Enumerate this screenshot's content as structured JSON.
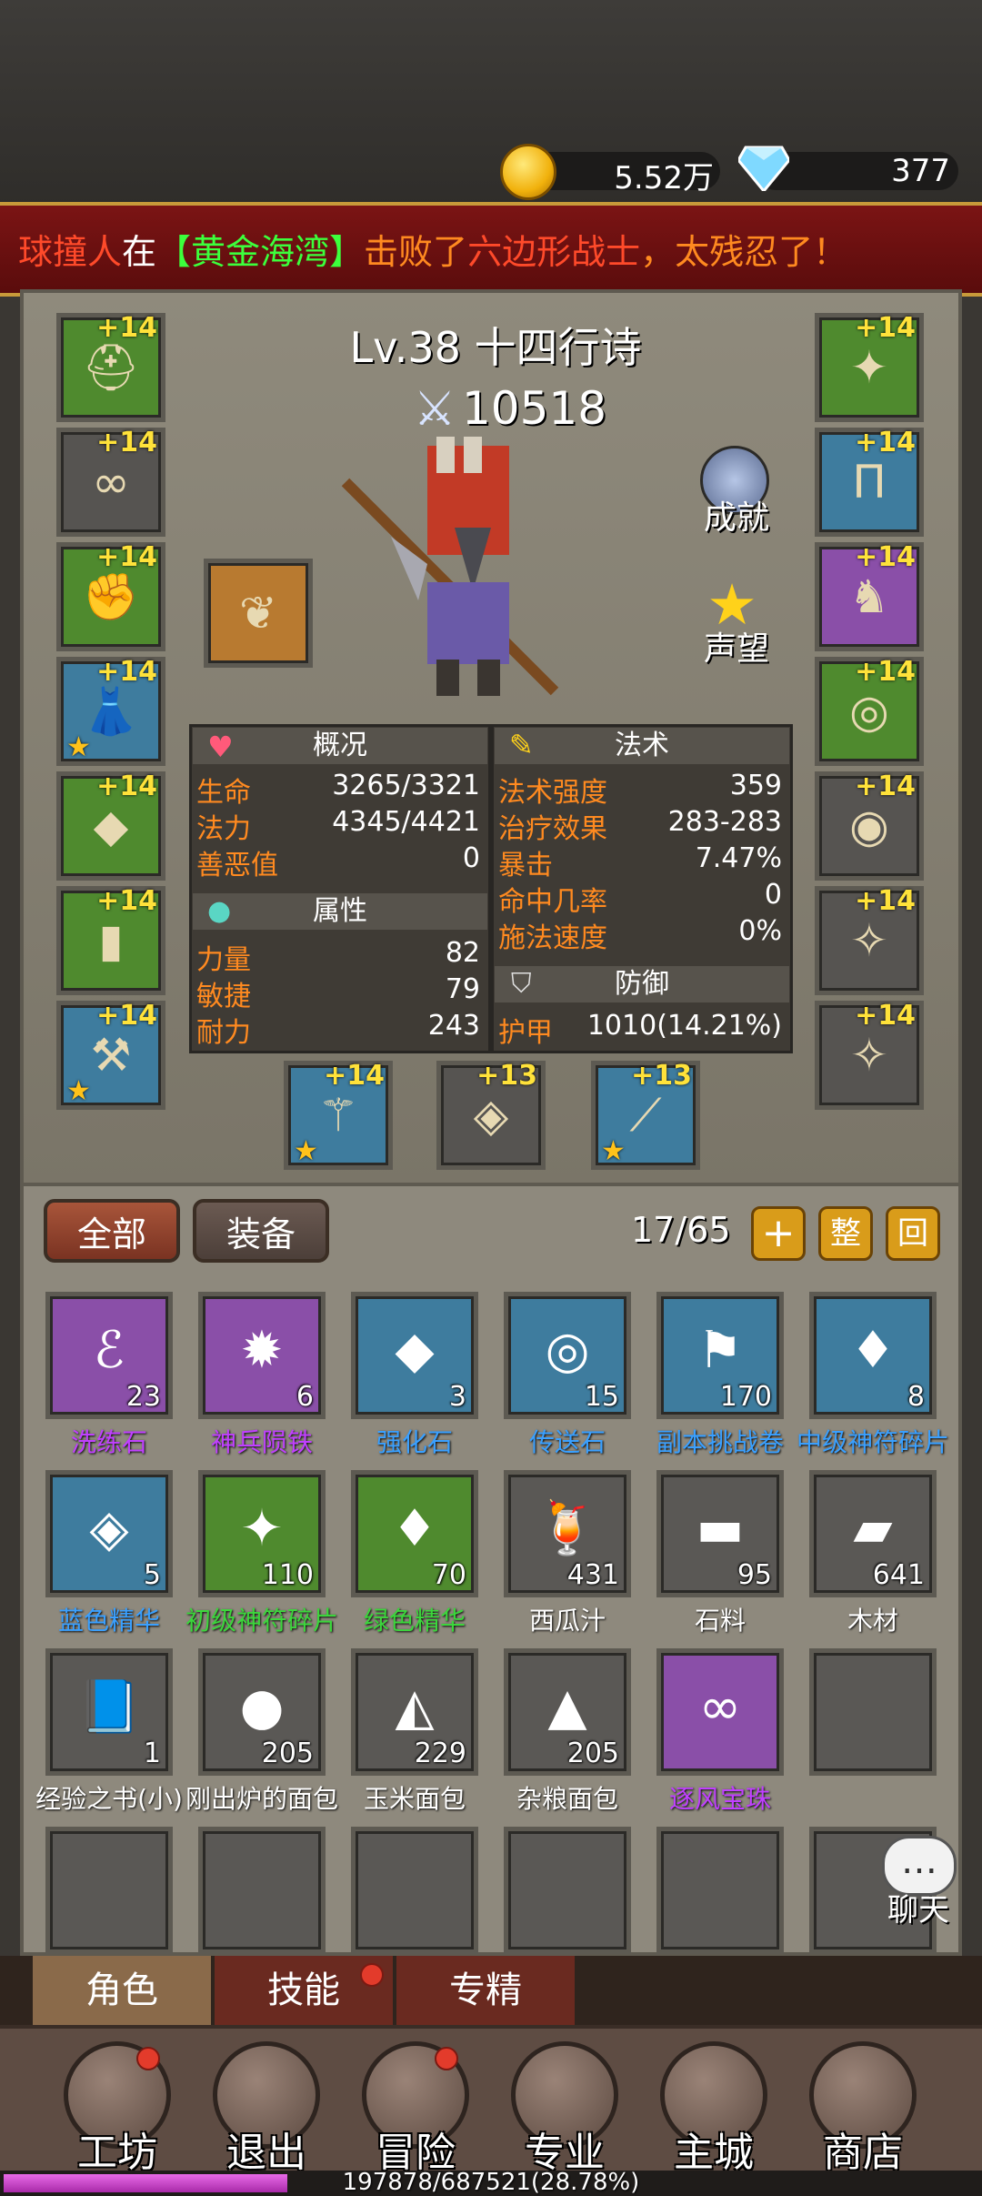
{
  "currency": {
    "gold": "5.52万",
    "diamond": "377"
  },
  "banner": {
    "part1": "球撞人",
    "part2": "在",
    "part3": "【黄金海湾】",
    "part4": "击败了",
    "part5": "六边形战士",
    "part6": "，太残忍了！"
  },
  "character": {
    "level_name": "Lv.38 十四行诗",
    "power": "10518",
    "achievement": "成就",
    "reputation": "声望"
  },
  "equip_left": [
    {
      "plus": "+14",
      "icon": "helmet-icon"
    },
    {
      "plus": "+14",
      "icon": "necklace-icon"
    },
    {
      "plus": "+14",
      "icon": "gauntlet-icon"
    },
    {
      "plus": "+14",
      "icon": "robe-icon"
    },
    {
      "plus": "+14",
      "icon": "cape-icon"
    },
    {
      "plus": "+14",
      "icon": "bracer-icon"
    },
    {
      "plus": "+14",
      "icon": "weapon-icon"
    }
  ],
  "equip_right": [
    {
      "plus": "+14",
      "icon": "shoulder-icon"
    },
    {
      "plus": "+14",
      "icon": "pants-icon"
    },
    {
      "plus": "+14",
      "icon": "boots-icon"
    },
    {
      "plus": "+14",
      "icon": "ring-icon"
    },
    {
      "plus": "+14",
      "icon": "belt-icon"
    },
    {
      "plus": "+14",
      "icon": "empty-slot-icon"
    },
    {
      "plus": "+14",
      "icon": "empty-slot-icon"
    }
  ],
  "equip_bottom": [
    {
      "plus": "+14"
    },
    {
      "plus": "+13"
    },
    {
      "plus": "+13"
    }
  ],
  "stats": {
    "overview_title": "概况",
    "overview": [
      {
        "label": "生命",
        "value": "3265/3321"
      },
      {
        "label": "法力",
        "value": "4345/4421"
      },
      {
        "label": "善恶值",
        "value": "0"
      }
    ],
    "attr_title": "属性",
    "attrs": [
      {
        "label": "力量",
        "value": "82"
      },
      {
        "label": "敏捷",
        "value": "79"
      },
      {
        "label": "耐力",
        "value": "243"
      }
    ],
    "magic_title": "法术",
    "magic": [
      {
        "label": "法术强度",
        "value": "359"
      },
      {
        "label": "治疗效果",
        "value": "283-283"
      },
      {
        "label": "暴击",
        "value": "7.47%"
      },
      {
        "label": "命中几率",
        "value": "0"
      },
      {
        "label": "施法速度",
        "value": "0%"
      }
    ],
    "defense_title": "防御",
    "defense": [
      {
        "label": "护甲",
        "value": "1010(14.21%)"
      }
    ]
  },
  "inventory": {
    "tab_all": "全部",
    "tab_equip": "装备",
    "capacity": "17/65",
    "add": "+",
    "sort": "整",
    "back": "回",
    "items": [
      {
        "name": "洗练石",
        "count": "23",
        "color": "#c040ff"
      },
      {
        "name": "神兵陨铁",
        "count": "6",
        "color": "#c040ff"
      },
      {
        "name": "强化石",
        "count": "3",
        "color": "#3aa0ff"
      },
      {
        "name": "传送石",
        "count": "15",
        "color": "#3aa0ff"
      },
      {
        "name": "副本挑战卷",
        "count": "170",
        "color": "#3aa0ff"
      },
      {
        "name": "中级神符碎片",
        "count": "8",
        "color": "#3aa0ff"
      },
      {
        "name": "蓝色精华",
        "count": "5",
        "color": "#3aa0ff"
      },
      {
        "name": "初级神符碎片",
        "count": "110",
        "color": "#3cd63c"
      },
      {
        "name": "绿色精华",
        "count": "70",
        "color": "#3cd63c"
      },
      {
        "name": "西瓜汁",
        "count": "431",
        "color": "#ffffff"
      },
      {
        "name": "石料",
        "count": "95",
        "color": "#ffffff"
      },
      {
        "name": "木材",
        "count": "641",
        "color": "#ffffff"
      },
      {
        "name": "经验之书(小)",
        "count": "1",
        "color": "#ffffff"
      },
      {
        "name": "刚出炉的面包",
        "count": "205",
        "color": "#ffffff"
      },
      {
        "name": "玉米面包",
        "count": "229",
        "color": "#ffffff"
      },
      {
        "name": "杂粮面包",
        "count": "205",
        "color": "#ffffff"
      },
      {
        "name": "逐风宝珠",
        "count": "",
        "color": "#c040ff"
      }
    ],
    "chat": "聊天"
  },
  "subtabs": [
    "角色",
    "技能",
    "专精"
  ],
  "nav": [
    "工坊",
    "退出",
    "冒险",
    "专业",
    "主城",
    "商店"
  ],
  "xp": "197878/687521(28.78%)"
}
